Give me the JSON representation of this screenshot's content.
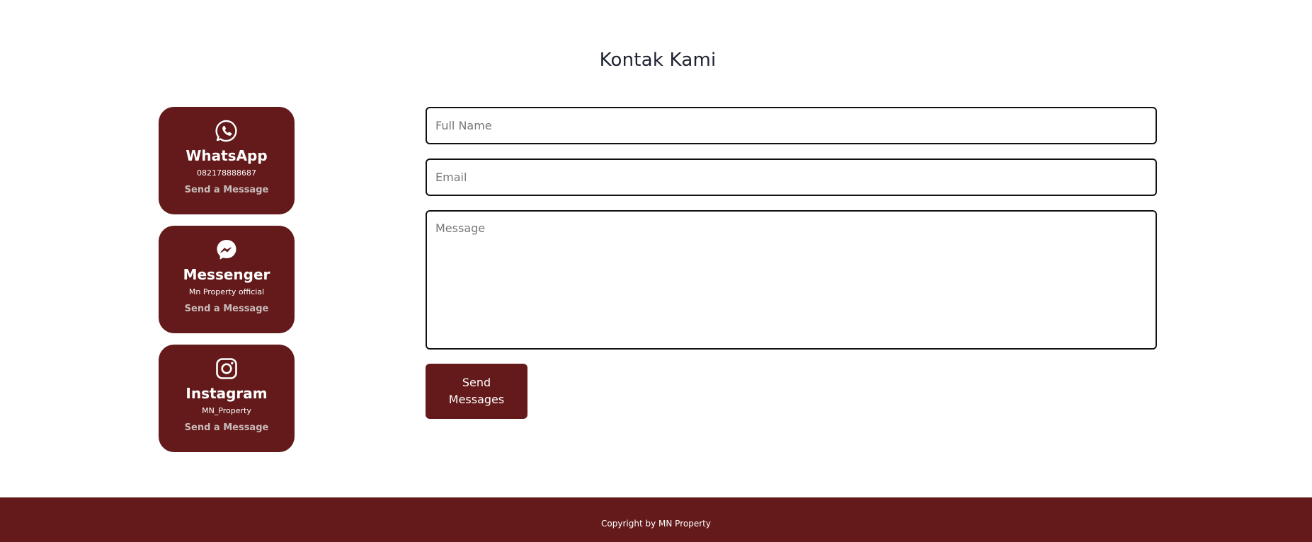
{
  "heading": "Kontak Kami",
  "contacts": [
    {
      "icon": "whatsapp-icon",
      "name": "WhatsApp",
      "detail": "082178888687",
      "link_label": "Send a Message"
    },
    {
      "icon": "messenger-icon",
      "name": "Messenger",
      "detail": "Mn Property official",
      "link_label": "Send a Message"
    },
    {
      "icon": "instagram-icon",
      "name": "Instagram",
      "detail": "MN_Property",
      "link_label": "Send a Message"
    }
  ],
  "form": {
    "full_name_placeholder": "Full Name",
    "email_placeholder": "Email",
    "message_placeholder": "Message",
    "submit_label": "Send Messages"
  },
  "footer": {
    "copyright": "Copyright by MN Property"
  },
  "colors": {
    "brand": "#641a1a",
    "card_link": "#c9bcbc",
    "heading": "#1f2230"
  }
}
